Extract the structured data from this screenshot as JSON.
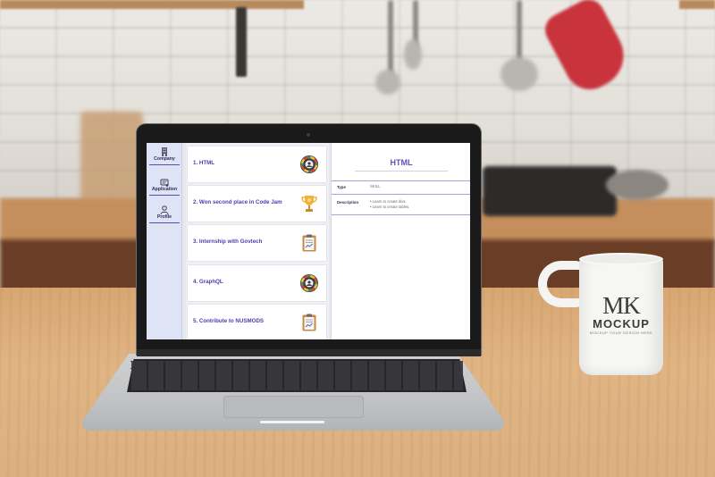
{
  "app": {
    "sidebar": {
      "items": [
        {
          "label": "Company",
          "icon": "building-icon"
        },
        {
          "label": "Application",
          "icon": "application-form-icon"
        },
        {
          "label": "Profile",
          "icon": "person-icon"
        }
      ]
    },
    "list": {
      "items": [
        {
          "label": "1.  HTML",
          "icon": "badge-icon"
        },
        {
          "label": "2.  Won second place in Code Jam",
          "icon": "trophy-icon"
        },
        {
          "label": "3.  Internship with Govtech",
          "icon": "clipboard-icon"
        },
        {
          "label": "4.  GraphQL",
          "icon": "badge-icon"
        },
        {
          "label": "5.  Contribute to NUSMODS",
          "icon": "clipboard-icon"
        }
      ]
    },
    "detail": {
      "title": "HTML",
      "type_label": "Type",
      "type_value": "SKILL",
      "description_label": "Description",
      "description_lines": [
        "• Learn to create divs.",
        "• Learn to create tables."
      ]
    }
  },
  "mug": {
    "monogram": "MK",
    "word": "MOCKUP",
    "tagline": "MOCKUP YOUR DESIGN HERE"
  },
  "colors": {
    "accent": "#5a4fc0",
    "sidebar_bg": "#dfe3f6",
    "label_text": "#4a3fb0"
  }
}
